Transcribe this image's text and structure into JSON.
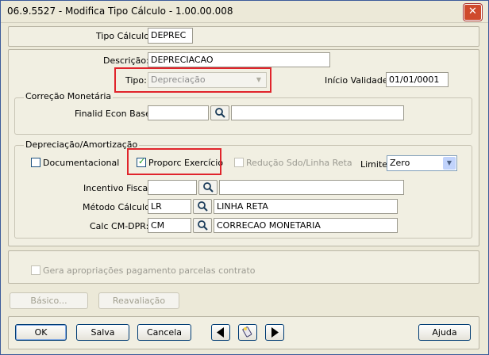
{
  "window": {
    "title": "06.9.5527 - Modifica Tipo Cálculo - 1.00.00.008",
    "close_glyph": "✕"
  },
  "header": {
    "tipo_calculo_label": "Tipo Cálculo:",
    "tipo_calculo_value": "DEPREC"
  },
  "main": {
    "descricao_label": "Descrição:",
    "descricao_value": "DEPRECIACAO",
    "tipo_label": "Tipo:",
    "tipo_value": "Depreciação",
    "inicio_label": "Início Validade:",
    "inicio_value": "01/01/0001"
  },
  "correcao": {
    "title": "Correção Monetária",
    "finalid_label": "Finalid Econ Base:",
    "finalid_code": "",
    "finalid_desc": ""
  },
  "depreciacao": {
    "title": "Depreciação/Amortização",
    "documentacional_label": "Documentacional",
    "documentacional_checked": false,
    "proporc_label": "Proporc Exercício",
    "proporc_checked": true,
    "reducao_label": "Redução Sdo/Linha Reta",
    "limite_label": "Limite:",
    "limite_value": "Zero",
    "incentivo_label": "Incentivo Fiscal:",
    "incentivo_code": "",
    "incentivo_desc": "",
    "metodo_label": "Método Cálculo:",
    "metodo_code": "LR",
    "metodo_desc": "LINHA RETA",
    "calc_label": "Calc CM-DPR:",
    "calc_code": "CM",
    "calc_desc": "CORRECAO MONETARIA"
  },
  "extra": {
    "gera_label": "Gera apropriações pagamento parcelas contrato",
    "basico_label": "Básico...",
    "reavaliacao_label": "Reavaliação"
  },
  "footer": {
    "ok_label": "OK",
    "salva_label": "Salva",
    "cancela_label": "Cancela",
    "ajuda_label": "Ajuda"
  }
}
